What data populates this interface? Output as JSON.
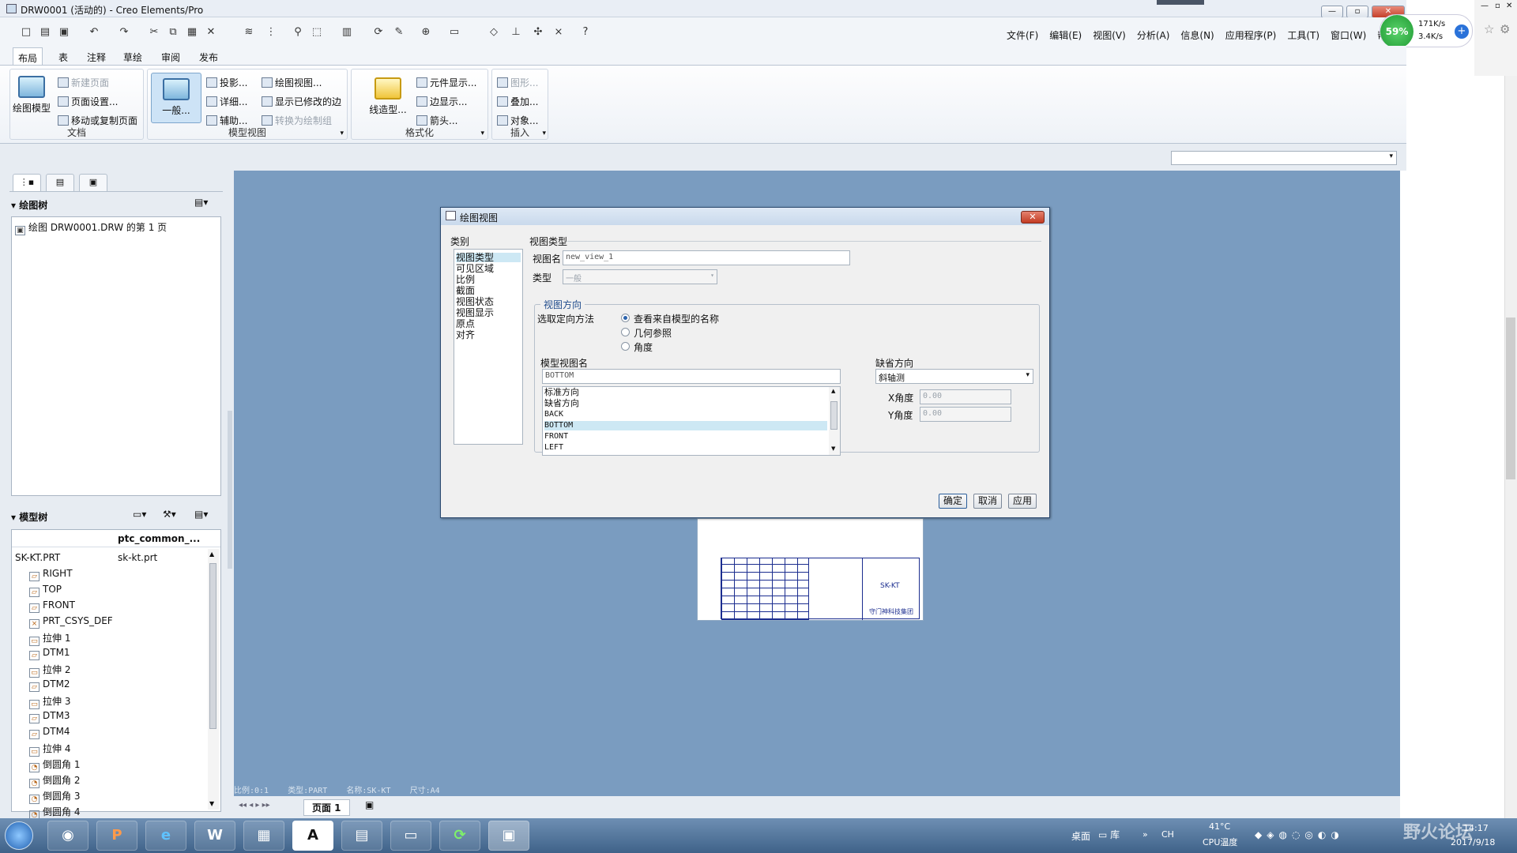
{
  "app": {
    "title": "DRW0001 (活动的) - Creo Elements/Pro",
    "menus": [
      "文件(F)",
      "编辑(E)",
      "视图(V)",
      "分析(A)",
      "信息(N)",
      "应用程序(P)",
      "工具(T)",
      "窗口(W)",
      "帮助"
    ]
  },
  "netmeter": {
    "percent": "59%",
    "up": "171K/s",
    "down": "3.4K/s"
  },
  "ribbon": {
    "tabs": [
      "布局",
      "表",
      "注释",
      "草绘",
      "审阅",
      "发布"
    ],
    "doc_group": {
      "label": "文档",
      "big": "绘图模型",
      "items": [
        "新建页面",
        "页面设置...",
        "移动或复制页面"
      ]
    },
    "model_group": {
      "label": "模型视图",
      "big": "一般...",
      "items": [
        "投影...",
        "详细...",
        "辅助...",
        "绘图视图...",
        "显示已修改的边",
        "转换为绘制组"
      ]
    },
    "format_group": {
      "label": "格式化",
      "big": "线造型...",
      "items": [
        "元件显示...",
        "边显示...",
        "箭头..."
      ]
    },
    "insert_group": {
      "label": "插入",
      "items": [
        "图形...",
        "叠加...",
        "对象..."
      ]
    }
  },
  "drawing_tree": {
    "title": "绘图树",
    "item": "绘图 DRW0001.DRW 的第 1 页"
  },
  "model_tree": {
    "title": "模型树",
    "column": "ptc_common_...",
    "root": {
      "name": "SK-KT.PRT",
      "value": "sk-kt.prt"
    },
    "items": [
      "RIGHT",
      "TOP",
      "FRONT",
      "PRT_CSYS_DEF",
      "拉伸 1",
      "DTM1",
      "拉伸 2",
      "DTM2",
      "拉伸 3",
      "DTM3",
      "DTM4",
      "拉伸 4",
      "倒圆角 1",
      "倒圆角 2",
      "倒圆角 3",
      "倒圆角 4"
    ]
  },
  "dialog": {
    "title": "绘图视图",
    "category_label": "类别",
    "categories": [
      "视图类型",
      "可见区域",
      "比例",
      "截面",
      "视图状态",
      "视图显示",
      "原点",
      "对齐"
    ],
    "section_title": "视图类型",
    "view_name_label": "视图名",
    "view_name": "new_view_1",
    "type_label": "类型",
    "type_value": "一般",
    "orientation_title": "视图方向",
    "method_label": "选取定向方法",
    "methods": [
      "查看来自模型的名称",
      "几何参照",
      "角度"
    ],
    "model_view_label": "模型视图名",
    "model_view_value": "BOTTOM",
    "views": [
      "标准方向",
      "缺省方向",
      "BACK",
      "BOTTOM",
      "FRONT",
      "LEFT"
    ],
    "default_dir_label": "缺省方向",
    "default_dir_value": "斜轴测",
    "x_angle_label": "X角度",
    "x_angle": "0.00",
    "y_angle_label": "Y角度",
    "y_angle": "0.00",
    "ok": "确定",
    "cancel": "取消",
    "apply": "应用"
  },
  "titleblock": {
    "part": "SK-KT",
    "company": "守门神科技集团"
  },
  "status": {
    "scale": "比例:0:1",
    "type": "类型:PART",
    "name": "名称:SK-KT",
    "size": "尺寸:A4"
  },
  "pagebar": {
    "page": "页面  1"
  },
  "taskbar": {
    "desktop": "桌面",
    "lib": "库",
    "temp": "41°C",
    "cpu": "CPU温度",
    "time": "14:17",
    "date": "2017/9/18",
    "forum": "野火论坛"
  }
}
